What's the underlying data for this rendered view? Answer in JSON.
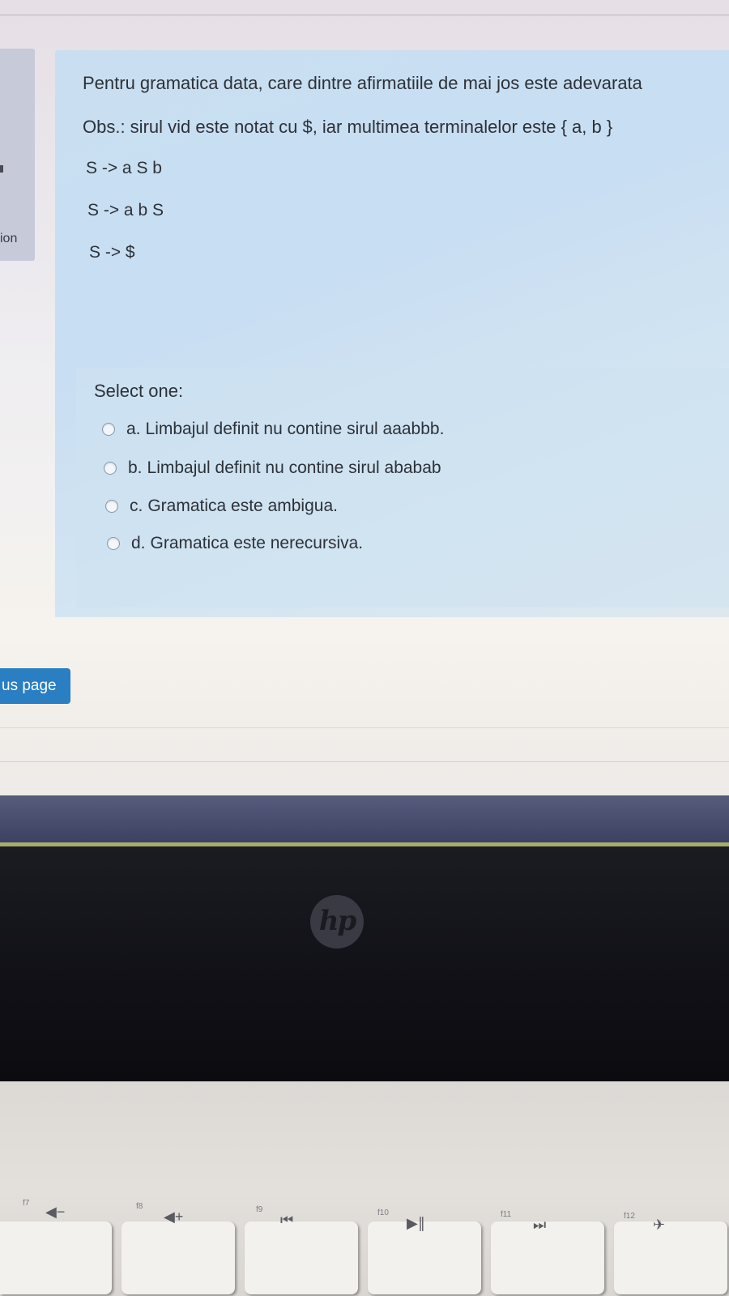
{
  "question": {
    "title": "Pentru gramatica data, care dintre afirmatiile de mai jos este adevarata",
    "note": "Obs.: sirul vid este notat cu $, iar multimea terminalelor este { a, b }",
    "rules": [
      "S -> a S b",
      "S -> a b S",
      "S -> $"
    ]
  },
  "answer": {
    "prompt": "Select one:",
    "options": [
      {
        "letter": "a.",
        "text": "Limbajul definit nu contine sirul aaabbb."
      },
      {
        "letter": "b.",
        "text": "Limbajul definit nu contine sirul ababab"
      },
      {
        "letter": "c.",
        "text": "Gramatica este ambigua."
      },
      {
        "letter": "d.",
        "text": "Gramatica este nerecursiva."
      }
    ]
  },
  "sidebar": {
    "fragment_text": "ion"
  },
  "nav": {
    "previous_label": "us page"
  },
  "device": {
    "logo_text": "hp"
  },
  "keyboard": {
    "keys": [
      {
        "fn": "f7",
        "glyph": "◀−"
      },
      {
        "fn": "f8",
        "glyph": "◀+"
      },
      {
        "fn": "f9",
        "glyph": "⏮"
      },
      {
        "fn": "f10",
        "glyph": "▶∥"
      },
      {
        "fn": "f11",
        "glyph": "⏭"
      },
      {
        "fn": "f12",
        "glyph": "✈"
      }
    ]
  },
  "colors": {
    "accent": "#2a7ec2",
    "question_bg": "#c9dff1",
    "text": "#2d3138"
  }
}
